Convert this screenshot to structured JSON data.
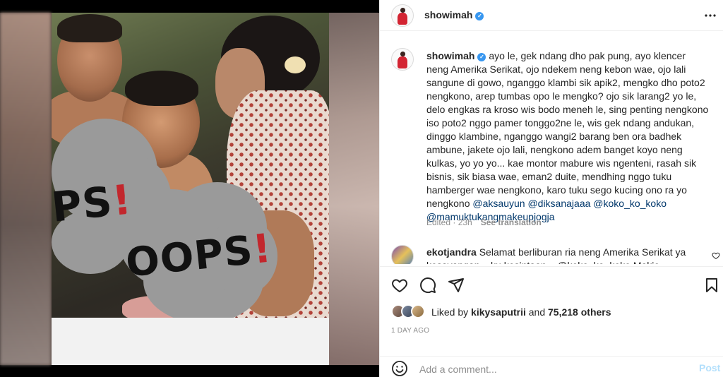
{
  "post": {
    "author": "showimah",
    "verified_mark": "✓"
  },
  "media": {
    "sticker_1": "PS",
    "sticker_1_bang": "!",
    "sticker_2": "OOPS",
    "sticker_2_bang": "!"
  },
  "caption": {
    "username": "showimah",
    "text": "ayo le, gek ndang dho pak pung, ayo klencer neng Amerika Serikat, ojo ndekem neng kebon wae, ojo lali sangune di gowo, nganggo klambi sik apik2, mengko dho poto2 nengkono, arep tumbas opo le mengko? ojo sik larang2 yo le, delo engkas ra kroso wis bodo meneh le, sing penting nengkono iso poto2 nggo pamer tonggo2ne le, wis gek ndang andukan, dinggo klambine, nganggo wangi2 barang ben ora badhek ambune, jakete ojo lali, nengkono adem banget koyo neng kulkas, yo yo yo... kae montor mabure wis ngenteni, rasah sik bisnis, sik biasa wae, eman2 duite, mendhing nggo tuku hamberger wae nengkono, karo tuku sego kucing ono ra yo nengkono ",
    "mentions": [
      "@aksauyun",
      "@diksanajaaa",
      "@koko_ko_koko",
      "@mamuktukangmakeupjogja"
    ],
    "edited": "Edited · 23h",
    "see_translation": "See translation"
  },
  "comment2": {
    "username": "ekotjandra",
    "text": "Selamat berliburan ria neng Amerika Serikat ya kesayangan... ku kesintaan... @koko_ko_koko Makie"
  },
  "likes": {
    "prefix": "Liked by ",
    "user": "kikysaputrii",
    "middle": " and ",
    "count": "75,218 others"
  },
  "timestamp": "1 DAY AGO",
  "add_comment": {
    "placeholder": "Add a comment...",
    "post_label": "Post"
  },
  "colors": {
    "verified": "#3897f0",
    "mention": "#00376b",
    "post_disabled": "#b2dffc"
  }
}
